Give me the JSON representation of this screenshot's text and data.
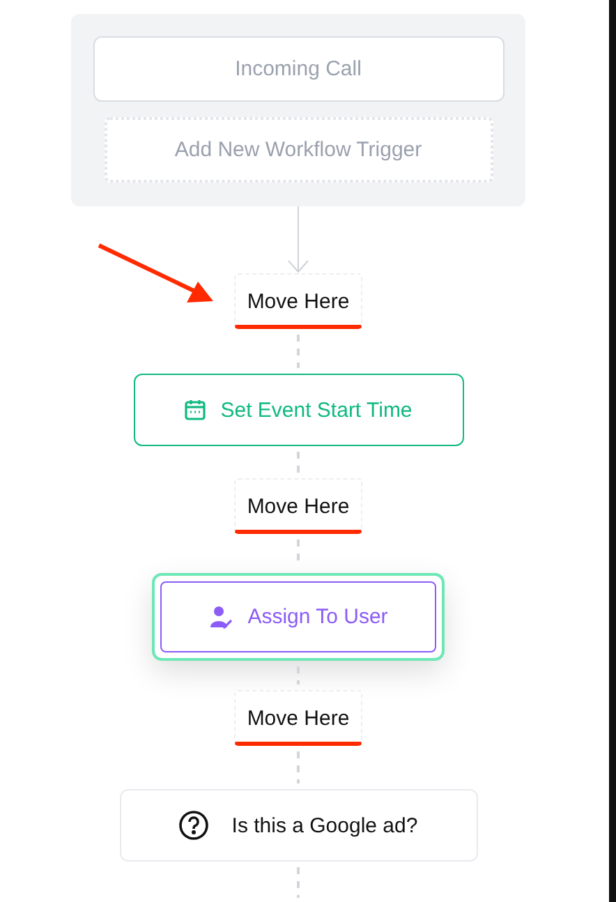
{
  "trigger_panel": {
    "triggers": [
      {
        "label": "Incoming Call"
      }
    ],
    "add_trigger": {
      "label": "Add New Workflow Trigger"
    }
  },
  "annotation": {
    "kind": "arrow"
  },
  "steps": [
    {
      "kind": "drop",
      "label": "Move Here",
      "highlighted": true
    },
    {
      "kind": "event-time",
      "label": "Set Event Start Time",
      "color": "#10b981",
      "selected": false
    },
    {
      "kind": "drop",
      "label": "Move Here",
      "highlighted": true
    },
    {
      "kind": "assign-user",
      "label": "Assign To User",
      "color": "#8b5cf6",
      "selected": true
    },
    {
      "kind": "drop",
      "label": "Move Here",
      "highlighted": true
    },
    {
      "kind": "condition",
      "label": "Is this a Google ad?",
      "color": "#111111",
      "selected": false
    }
  ]
}
